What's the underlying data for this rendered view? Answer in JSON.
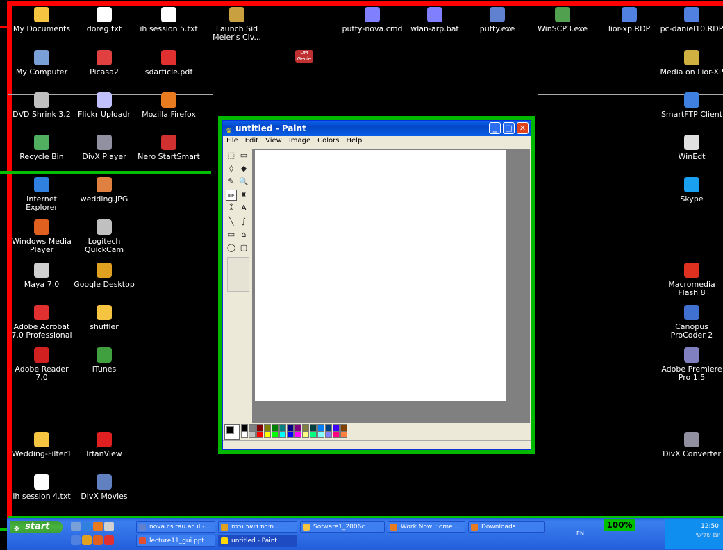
{
  "desktop": {
    "icons": [
      {
        "label": "My Documents",
        "icon": "folder-icon",
        "color": "#f5c542"
      },
      {
        "label": "doreg.txt",
        "icon": "text-file-icon",
        "color": "#ffffff"
      },
      {
        "label": "ih session 5.txt",
        "icon": "text-file-icon",
        "color": "#ffffff"
      },
      {
        "label": "Launch Sid Meier's Civ...",
        "icon": "game-icon",
        "color": "#c8a040"
      },
      {
        "label": "putty-nova.cmd",
        "icon": "batch-file-icon",
        "color": "#8080ff"
      },
      {
        "label": "wlan-arp.bat",
        "icon": "batch-file-icon",
        "color": "#8080ff"
      },
      {
        "label": "putty.exe",
        "icon": "putty-icon",
        "color": "#6080d0"
      },
      {
        "label": "WinSCP3.exe",
        "icon": "winscp-icon",
        "color": "#50a050"
      },
      {
        "label": "lior-xp.RDP",
        "icon": "remote-desktop-icon",
        "color": "#5080e0"
      },
      {
        "label": "pc-daniel10.RDP",
        "icon": "remote-desktop-icon",
        "color": "#5080e0"
      },
      {
        "label": "My Computer",
        "icon": "computer-icon",
        "color": "#7aa0d8"
      },
      {
        "label": "Picasa2",
        "icon": "picasa-icon",
        "color": "#e04040"
      },
      {
        "label": "sdarticle.pdf",
        "icon": "pdf-icon",
        "color": "#e03030"
      },
      {
        "label": "Media on Lior-XP",
        "icon": "network-drive-icon",
        "color": "#d0b040"
      },
      {
        "label": "DVD Shrink 3.2",
        "icon": "dvd-icon",
        "color": "#c0c0c0"
      },
      {
        "label": "Flickr Uploadr",
        "icon": "flickr-icon",
        "color": "#c0c0ff"
      },
      {
        "label": "Mozilla Firefox",
        "icon": "firefox-icon",
        "color": "#e87a20"
      },
      {
        "label": "SmartFTP Client",
        "icon": "ftp-icon",
        "color": "#4080e0"
      },
      {
        "label": "Recycle Bin",
        "icon": "recycle-bin-icon",
        "color": "#50b060"
      },
      {
        "label": "DivX Player",
        "icon": "divx-icon",
        "color": "#9090a0"
      },
      {
        "label": "Nero StartSmart",
        "icon": "nero-icon",
        "color": "#d03030"
      },
      {
        "label": "WinEdt",
        "icon": "winedt-icon",
        "color": "#e0e0e0"
      },
      {
        "label": "Internet Explorer",
        "icon": "ie-icon",
        "color": "#3080e0"
      },
      {
        "label": "wedding.JPG",
        "icon": "image-file-icon",
        "color": "#e08040"
      },
      {
        "label": "Skype",
        "icon": "skype-icon",
        "color": "#1aa0f0"
      },
      {
        "label": "Windows Media Player",
        "icon": "media-player-icon",
        "color": "#e06020"
      },
      {
        "label": "Logitech QuickCam",
        "icon": "webcam-icon",
        "color": "#c0c0c0"
      },
      {
        "label": "Maya 7.0",
        "icon": "maya-icon",
        "color": "#d0d0d0"
      },
      {
        "label": "Google Desktop",
        "icon": "google-desktop-icon",
        "color": "#e0a020"
      },
      {
        "label": "Macromedia Flash 8",
        "icon": "flash-icon",
        "color": "#e03020"
      },
      {
        "label": "Adobe Acrobat 7.0 Professional",
        "icon": "acrobat-icon",
        "color": "#e03030"
      },
      {
        "label": "shuffler",
        "icon": "folder-icon",
        "color": "#f5c542"
      },
      {
        "label": "Canopus ProCoder 2",
        "icon": "procoder-icon",
        "color": "#4070d0"
      },
      {
        "label": "Adobe Reader 7.0",
        "icon": "adobe-reader-icon",
        "color": "#d02020"
      },
      {
        "label": "iTunes",
        "icon": "itunes-icon",
        "color": "#40a040"
      },
      {
        "label": "Adobe Premiere Pro 1.5",
        "icon": "premiere-icon",
        "color": "#8080c0"
      },
      {
        "label": "Wedding-Filter1",
        "icon": "folder-icon",
        "color": "#f5c542"
      },
      {
        "label": "IrfanView",
        "icon": "irfanview-icon",
        "color": "#e02020"
      },
      {
        "label": "DivX Converter",
        "icon": "divx-converter-icon",
        "color": "#9090a0"
      },
      {
        "label": "ih session 4.txt",
        "icon": "text-file-icon",
        "color": "#ffffff"
      },
      {
        "label": "DivX Movies",
        "icon": "divx-movies-icon",
        "color": "#6080c0"
      }
    ],
    "stray_label": "DM Genie"
  },
  "paint": {
    "title": "untitled - Paint",
    "menu": [
      "File",
      "Edit",
      "View",
      "Image",
      "Colors",
      "Help"
    ],
    "buttons": {
      "minimize": "_",
      "maximize": "□",
      "close": "✕"
    },
    "tools": [
      "free-select-icon",
      "rect-select-icon",
      "eraser-icon",
      "fill-icon",
      "eyedropper-icon",
      "magnifier-icon",
      "pencil-icon",
      "brush-icon",
      "airbrush-icon",
      "text-icon",
      "line-icon",
      "curve-icon",
      "rectangle-icon",
      "polygon-icon",
      "ellipse-icon",
      "rounded-rect-icon"
    ],
    "tool_glyphs": [
      "⬚",
      "▭",
      "◊",
      "◆",
      "✎",
      "🔍",
      "✏",
      "♜",
      "⁑",
      "A",
      "╲",
      "∫",
      "▭",
      "⌂",
      "◯",
      "▢"
    ],
    "palette_top": [
      "#000000",
      "#808080",
      "#800000",
      "#808000",
      "#008000",
      "#008080",
      "#000080",
      "#800080",
      "#808040",
      "#004040",
      "#0080ff",
      "#004080",
      "#4000ff",
      "#804000"
    ],
    "palette_bottom": [
      "#ffffff",
      "#c0c0c0",
      "#ff0000",
      "#ffff00",
      "#00ff00",
      "#00ffff",
      "#0000ff",
      "#ff00ff",
      "#ffff80",
      "#00ff80",
      "#80ffff",
      "#8080ff",
      "#ff0080",
      "#ff8040"
    ]
  },
  "taskbar": {
    "start_label": "start",
    "buttons_row1": [
      "nova.cs.tau.ac.il -...",
      "תיבת דואר נכנס ...",
      "Sofware1_2006c",
      "Work Now Home ...",
      "Downloads"
    ],
    "buttons_row2": [
      "lecture11_gui.ppt",
      "untitled - Paint"
    ],
    "zoom": "100%",
    "lang": "EN",
    "time": "12:50",
    "day": "יום שלישי"
  },
  "colors": {
    "annotation_red": "#ff0000",
    "annotation_green": "#00c000",
    "xp_blue": "#245edb"
  }
}
